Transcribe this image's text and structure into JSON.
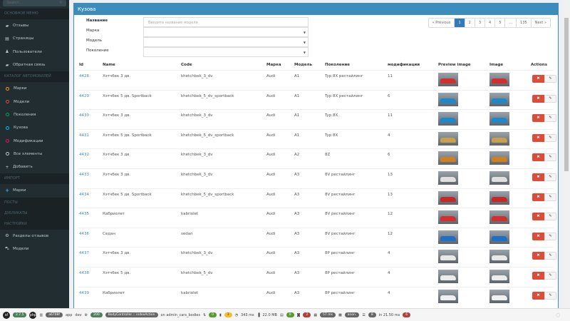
{
  "sidebar": {
    "search_placeholder": "Search...",
    "sections": {
      "main": "ОСНОВНОЕ МЕНЮ",
      "catalog": "КАТАЛОГ АВТОМОБИЛЕЙ",
      "import": "ИМПОРТ",
      "posts": "ПОСТЫ",
      "duplicates": "ДУБЛИКАТЫ",
      "settings": "НАСТРОЙКИ"
    },
    "main_items": [
      {
        "label": "Отзывы",
        "icon": "comments-icon"
      },
      {
        "label": "Страницы",
        "icon": "files-icon"
      },
      {
        "label": "Пользователи",
        "icon": "user-icon"
      },
      {
        "label": "Обратная связь",
        "icon": "comments-icon"
      }
    ],
    "catalog_items": [
      {
        "label": "Марки",
        "color": "#f39c12"
      },
      {
        "label": "Модели",
        "color": "#dd4b39"
      },
      {
        "label": "Поколения",
        "color": "#00a65a"
      },
      {
        "label": "Кузова",
        "color": "#00c0ef"
      },
      {
        "label": "Модификации",
        "color": "#d81b60"
      },
      {
        "label": "Все элементы",
        "color": "#b8c7ce"
      }
    ],
    "add_label": "Добавить",
    "import_items": [
      {
        "label": "Марки"
      }
    ],
    "settings_items": [
      {
        "label": "Разделы отзывов",
        "icon": "gear-icon"
      },
      {
        "label": "Модели",
        "icon": "car-icon"
      }
    ]
  },
  "card": {
    "title": "Кузова",
    "accent": "#3c8dbc"
  },
  "filters": {
    "name_label": "Название",
    "name_placeholder": "Введите название модели",
    "brand_label": "Марка",
    "model_label": "Модель",
    "generation_label": "Поколение"
  },
  "pagination": {
    "prev": "« Previous",
    "pages": [
      "1",
      "2",
      "3",
      "4",
      "5",
      "...",
      "135"
    ],
    "active": "1",
    "next": "Next »"
  },
  "table": {
    "columns": [
      "Id",
      "Name",
      "Code",
      "Марка",
      "Модель",
      "Поколение",
      "модификации",
      "Preview image",
      "Image",
      "Actions"
    ],
    "rows": [
      {
        "id": "4428",
        "name": "Хэтчбек 3 дв.",
        "code": "khetchbek_3_dv",
        "brand": "Audi",
        "model": "A1",
        "generation": "Typ 8X рестайлинг",
        "mods": "11",
        "car_color": "#d32f2f"
      },
      {
        "id": "4429",
        "name": "Хэтчбек 5 дв. Sportback",
        "code": "khetchbek_5_dv_sportback",
        "brand": "Audi",
        "model": "A1",
        "generation": "Typ 8X рестайлинг",
        "mods": "6",
        "car_color": "#1e88c8"
      },
      {
        "id": "4430",
        "name": "Хэтчбек 3 дв.",
        "code": "khetchbek_3_dv",
        "brand": "Audi",
        "model": "A1",
        "generation": "Typ 8X",
        "mods": "11",
        "car_color": "#1e88c8"
      },
      {
        "id": "4431",
        "name": "Хэтчбек 5 дв. Sportback",
        "code": "khetchbek_5_dv_sportback",
        "brand": "Audi",
        "model": "A1",
        "generation": "Typ 8X",
        "mods": "4",
        "car_color": "#c8a050"
      },
      {
        "id": "4432",
        "name": "Хэтчбек 3 дв.",
        "code": "khetchbek_3_dv",
        "brand": "Audi",
        "model": "A2",
        "generation": "8Z",
        "mods": "6",
        "car_color": "#d08020"
      },
      {
        "id": "4433",
        "name": "Хэтчбек 3 дв.",
        "code": "khetchbek_3_dv",
        "brand": "Audi",
        "model": "A3",
        "generation": "8V рестайлинг",
        "mods": "13",
        "car_color": "#e0e0e0"
      },
      {
        "id": "4434",
        "name": "Хэтчбек 5 дв. Sportback",
        "code": "khetchbek_5_dv_sportback",
        "brand": "Audi",
        "model": "A3",
        "generation": "8V рестайлинг",
        "mods": "13",
        "car_color": "#c62828"
      },
      {
        "id": "4435",
        "name": "Кабриолет",
        "code": "kabriolet",
        "brand": "Audi",
        "model": "A3",
        "generation": "8V рестайлинг",
        "mods": "12",
        "car_color": "#d32f2f"
      },
      {
        "id": "4436",
        "name": "Седан",
        "code": "sedan",
        "brand": "Audi",
        "model": "A3",
        "generation": "8V рестайлинг",
        "mods": "12",
        "car_color": "#1e6fc8"
      },
      {
        "id": "4437",
        "name": "Хэтчбек 3 дв.",
        "code": "khetchbek_3_dv",
        "brand": "Audi",
        "model": "A3",
        "generation": "8P рестайлинг",
        "mods": "4",
        "car_color": "#e8e8e8"
      },
      {
        "id": "4438",
        "name": "Хэтчбек 5 дв.",
        "code": "khetchbek_5_dv",
        "brand": "Audi",
        "model": "A3",
        "generation": "8P рестайлинг",
        "mods": "4",
        "car_color": "#ececec"
      },
      {
        "id": "4439",
        "name": "Кабриолет",
        "code": "kabriolet",
        "brand": "Audi",
        "model": "A3",
        "generation": "8P рестайлинг",
        "mods": "4",
        "car_color": "#f0f0f0"
      }
    ],
    "delete_icon": "times-icon",
    "edit_icon": "pencil-icon"
  },
  "toolbar": {
    "symfony_version": "2.7.5",
    "token": "a6708f",
    "env_app": "app",
    "env": "dev",
    "status": "200",
    "controller": "BodyController :: indexAction",
    "route": "on admin_cars_bodies",
    "ajax": "0",
    "logs": "3",
    "time": "343 ms",
    "memory": "22.0 MB",
    "forms": "0",
    "cache": "2",
    "twig_time": "57 ms",
    "user": "anon.",
    "db_queries": "8",
    "db_time": "in 21.50 ms",
    "db_errors": "6"
  }
}
